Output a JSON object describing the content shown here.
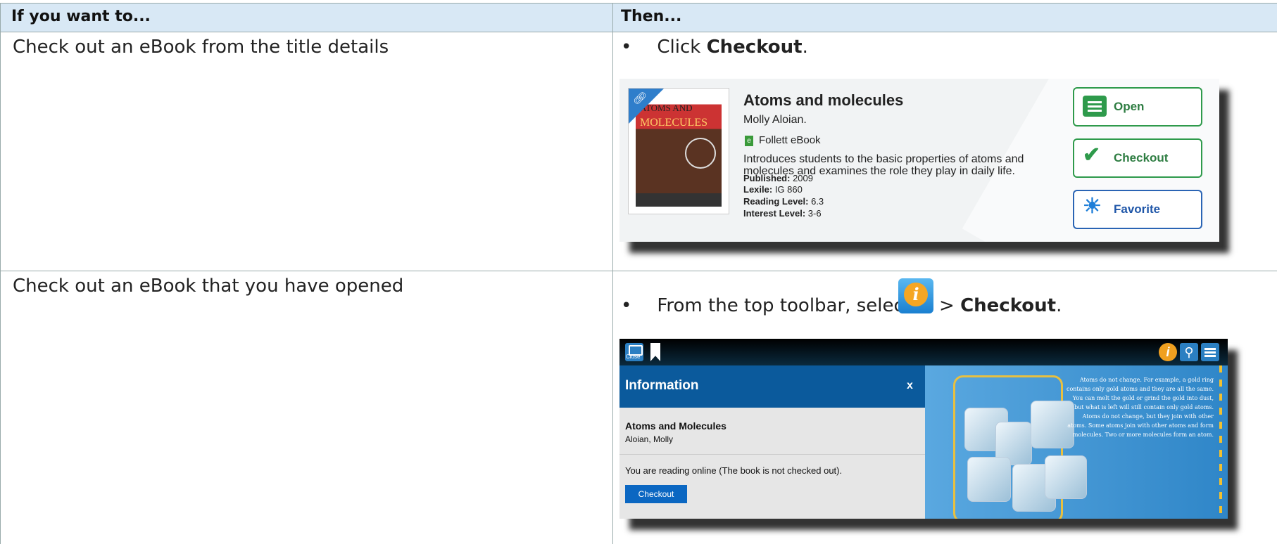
{
  "table": {
    "header": {
      "col1": "If you want to...",
      "col2": "Then..."
    },
    "rows": [
      {
        "want": "Check out an eBook from the title details",
        "step_prefix": "Click ",
        "step_bold": "Checkout",
        "step_suffix": "."
      },
      {
        "want": "Check out an eBook that you have opened",
        "step_prefix": "From the top toolbar, select ",
        "step_mid": " > ",
        "step_bold": "Checkout",
        "step_suffix": "."
      }
    ]
  },
  "bullet_char": "•",
  "title_details": {
    "cover_line1": "ATOMS AND",
    "cover_line2": "MOLECULES",
    "title": "Atoms and molecules",
    "author": "Molly Aloian.",
    "format": "Follett eBook",
    "description": "Introduces students to the basic properties of atoms and molecules and examines the role they play in daily life.",
    "published_label": "Published:",
    "published": "2009",
    "lexile_label": "Lexile:",
    "lexile": "IG 860",
    "reading_label": "Reading Level:",
    "reading": "6.3",
    "interest_label": "Interest Level:",
    "interest": "3-6",
    "buttons": {
      "open": "Open",
      "checkout": "Checkout",
      "favorite": "Favorite"
    }
  },
  "reader": {
    "close_label": "Close",
    "info_title": "Information",
    "close_x": "x",
    "book_title": "Atoms and Molecules",
    "book_author": "Aloian, Molly",
    "status": "You are reading online (The book is not checked out).",
    "checkout_label": "Checkout",
    "page_text": "Atoms do not change. For example, a gold ring contains only gold atoms and they are all the same. You can melt the gold or grind the gold into dust, but what is left will still contain only gold atoms. Atoms do not change, but they join with other atoms. Some atoms join with other atoms and form molecules. Two or more molecules form an atom."
  },
  "colors": {
    "header_bg": "#d8e8f5",
    "green": "#2e9a4b",
    "blue": "#2a64b4",
    "info_blue": "#0b5a9c"
  },
  "icons": [
    "info-icon",
    "search-icon",
    "menu-icon",
    "bookmark-icon",
    "book-icon",
    "link-icon",
    "checkmark-icon",
    "sun-icon",
    "list-icon"
  ]
}
